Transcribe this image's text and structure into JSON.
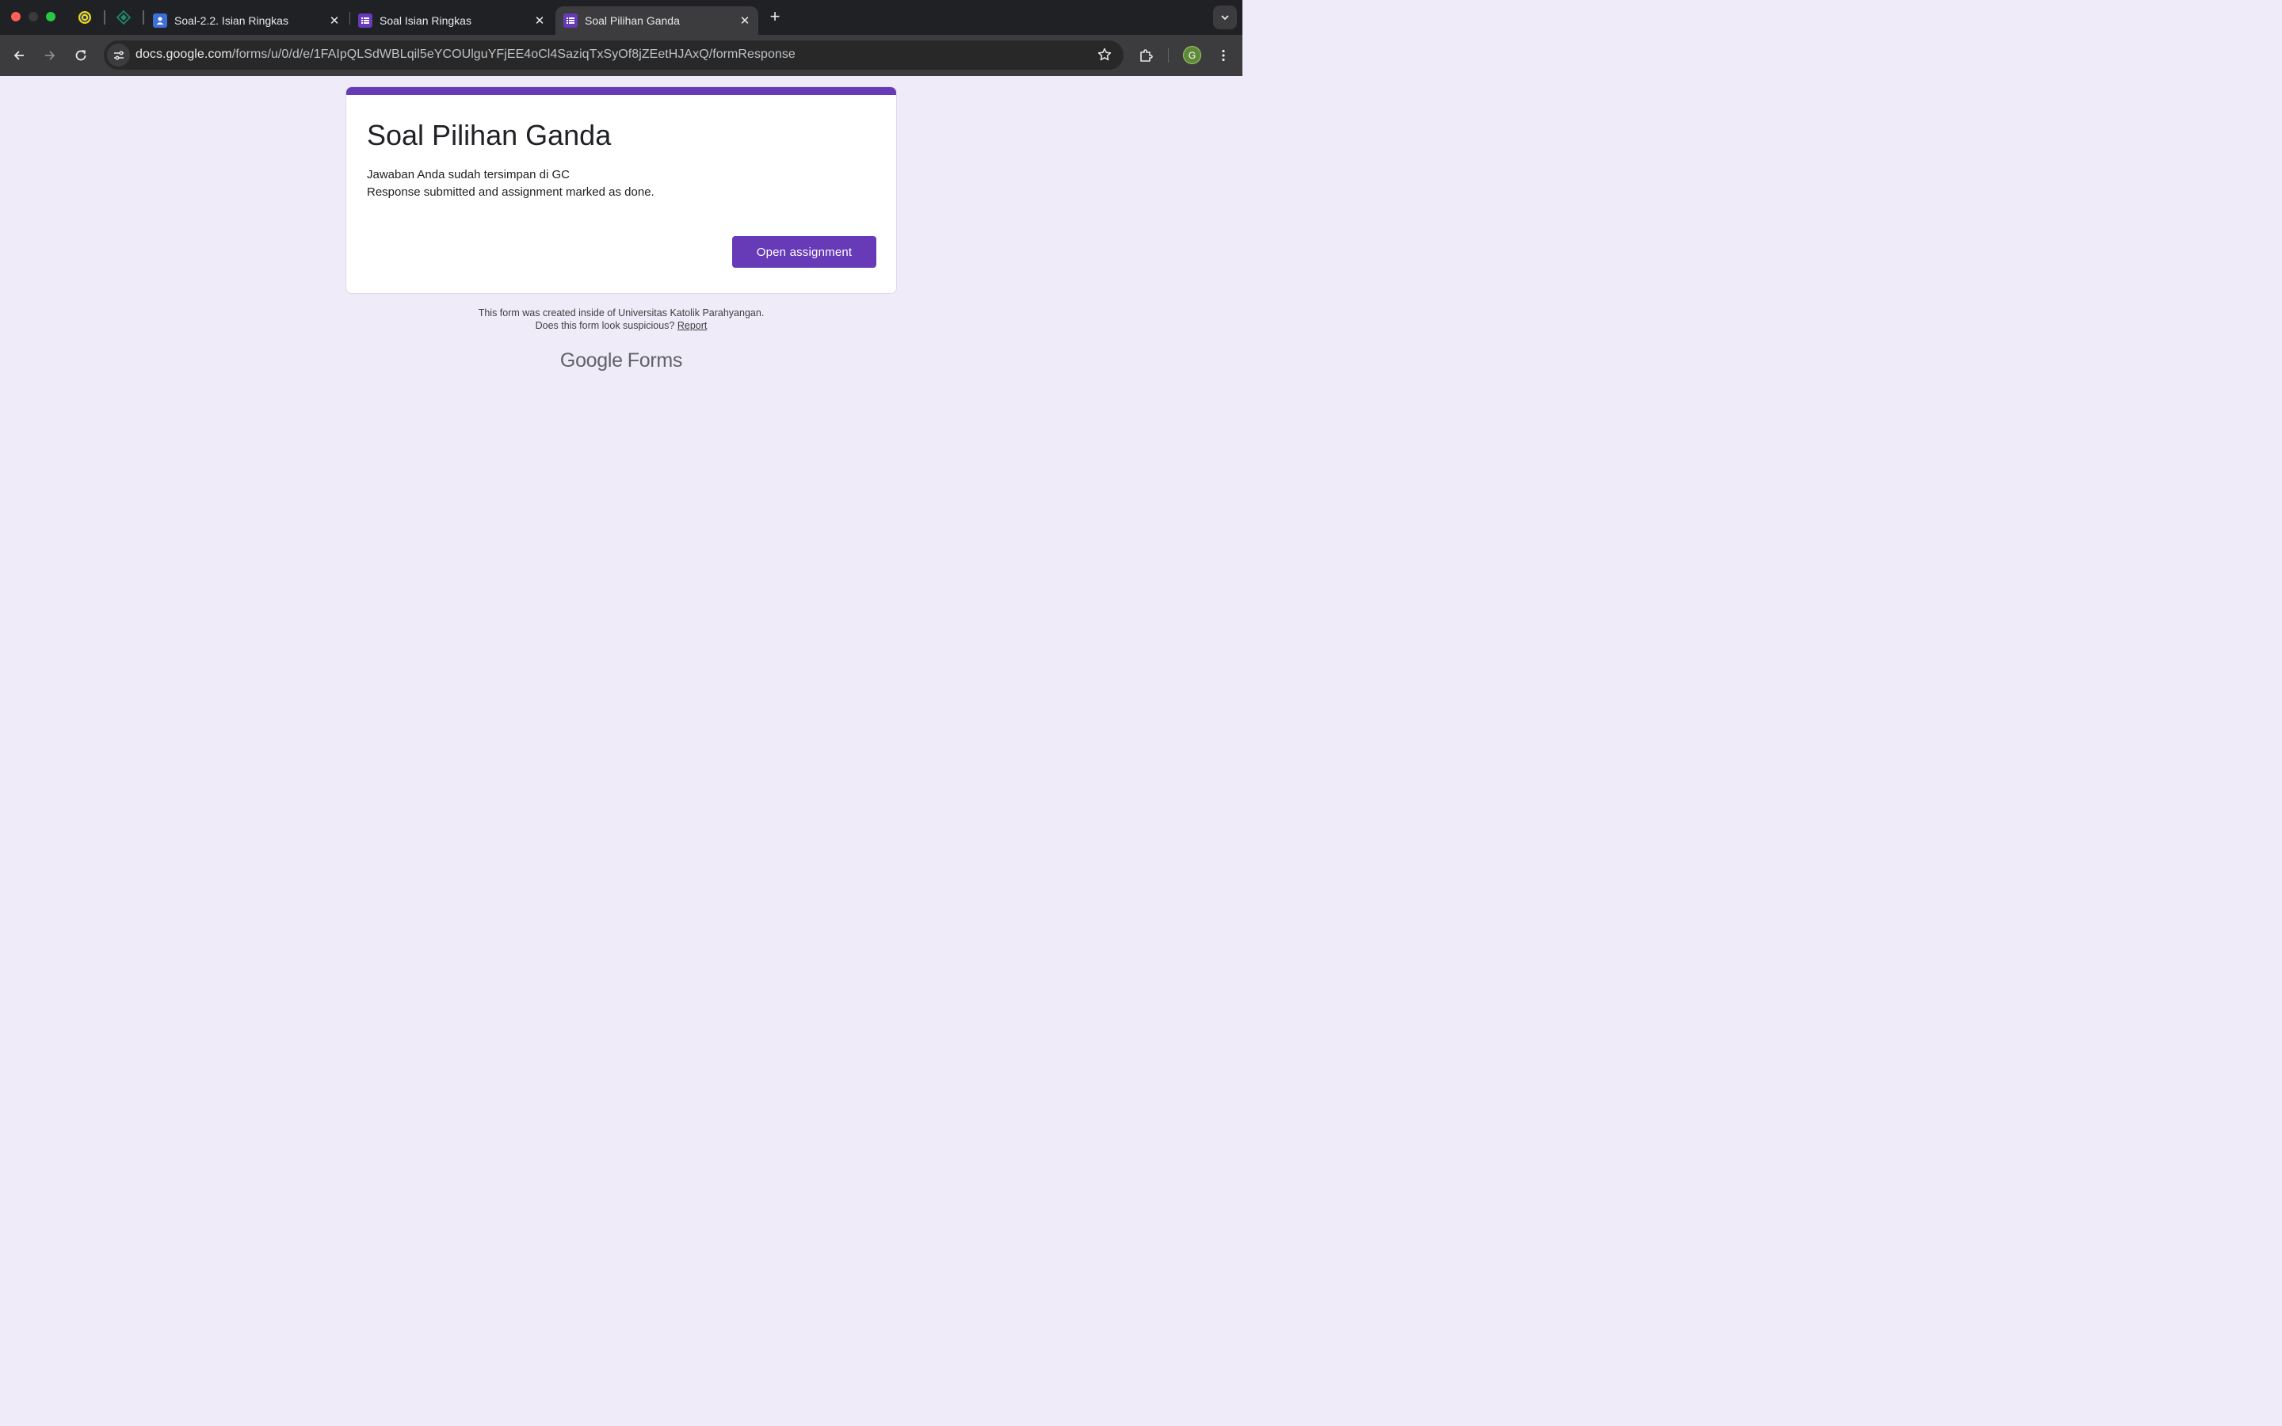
{
  "browser": {
    "tabs": [
      {
        "title": "Soal-2.2. Isian Ringkas",
        "favicon": "classroom-icon",
        "active": false
      },
      {
        "title": "Soal Isian Ringkas",
        "favicon": "forms-icon",
        "active": false
      },
      {
        "title": "Soal Pilihan Ganda",
        "favicon": "forms-icon",
        "active": true
      }
    ],
    "url_host": "docs.google.com",
    "url_path": "/forms/u/0/d/e/1FAIpQLSdWBLqil5eYCOUlguYFjEE4oCl4SaziqTxSyOf8jZEetHJAxQ/formResponse",
    "profile_initial": "G"
  },
  "form": {
    "title": "Soal Pilihan Ganda",
    "message_line1": "Jawaban Anda sudah tersimpan di GC",
    "message_line2": "Response submitted and assignment marked as done.",
    "open_button": "Open assignment"
  },
  "footer": {
    "created_inside": "This form was created inside of Universitas Katolik Parahyangan.",
    "suspicious": "Does this form look suspicious?",
    "report_link": "Report",
    "logo_google": "Google",
    "logo_forms": "Forms"
  },
  "colors": {
    "accent": "#673ab7",
    "page_bg": "#f0ebf8"
  }
}
